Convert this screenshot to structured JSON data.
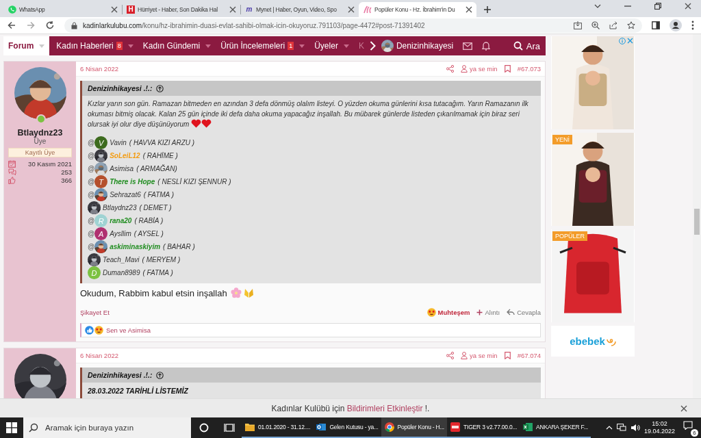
{
  "browser": {
    "tabs": [
      {
        "title": "WhatsApp",
        "selected": false
      },
      {
        "title": "Hürriyet - Haber, Son Dakika Hal",
        "icon_letter": "H",
        "selected": false
      },
      {
        "title": "Mynet | Haber, Oyun, Video, Spo",
        "icon_letter": "m",
        "selected": false
      },
      {
        "title": "Popüler Konu - Hz. İbrahim'in Du",
        "selected": true
      }
    ],
    "url_host": "kadinlarkulubu.com",
    "url_path": "/konu/hz-ibrahimin-duasi-evlat-sahibi-olmak-icin-okuyoruz.791103/page-4472#post-71391402"
  },
  "nav": {
    "items": [
      {
        "label": "Forum",
        "selected": true
      },
      {
        "label": "Kadın Haberleri",
        "badge": "8",
        "selected": false
      },
      {
        "label": "Kadın Gündemi",
        "selected": false
      },
      {
        "label": "Ürün İncelemeleri",
        "badge": "1",
        "selected": false
      },
      {
        "label": "Üyeler",
        "selected": false
      },
      {
        "label": "K",
        "selected": false,
        "faded": true
      }
    ],
    "user": "Denizinhikayesi",
    "search": "Ara"
  },
  "posts": [
    {
      "user": {
        "name": "Btlaydnz23",
        "title": "Üye",
        "banner": "Kayıtlı Üye",
        "online": true,
        "stats": [
          {
            "kind": "calendar",
            "value": "30 Kasım 2021"
          },
          {
            "kind": "messages",
            "value": "253"
          },
          {
            "kind": "likes",
            "value": "366"
          }
        ]
      },
      "date": "6 Nisan 2022",
      "author_link": "ya se min",
      "number": "#67.073",
      "quote": {
        "author": "Denizinhikayesi .!.:",
        "text": "Kızlar yarın son gün. Ramazan bitmeden en azından 3 defa dönmüş olalım listeyi. O yüzden okuma günlerini kısa tutacağım. Yarın Ramazanın ilk okuması bitmiş olacak. Kalan 25 gün içinde iki defa daha okuma yapacağız inşallah. Bu mübarek günlerde listeden çıkarılmamak için biraz seri olursak iyi olur diye düşünüyorum",
        "mentions": [
          {
            "prefix": "@",
            "avatar": {
              "kind": "letter",
              "letter": "V",
              "color": "#3d6b1e"
            },
            "name": "Vavin",
            "note": "( HAVVA KIZI ARZU )"
          },
          {
            "prefix": "@",
            "avatar": {
              "kind": "picture"
            },
            "name": "SoLeiL12",
            "color": "#f39c12",
            "note": "( RAHİME )"
          },
          {
            "prefix": "@",
            "avatar": {
              "kind": "picture"
            },
            "name": "Asimisa",
            "note": "( ARMAĞAN)"
          },
          {
            "prefix": "@",
            "avatar": {
              "kind": "letter",
              "letter": "T",
              "color": "#b5502d"
            },
            "name": "There is Hope",
            "color": "#1e8c1e",
            "note": "( NESLİ KIZI ŞENNUR )"
          },
          {
            "prefix": "@",
            "avatar": {
              "kind": "picture"
            },
            "name": "Sehrazat6",
            "note": "( FATMA )"
          },
          {
            "avatar": {
              "kind": "picture"
            },
            "name": "Btlaydnz23",
            "note": "( DEMET )"
          },
          {
            "prefix": "@",
            "avatar": {
              "kind": "letter",
              "letter": "R",
              "color": "#9fd3d3"
            },
            "name": "rana20",
            "color": "#1e8c1e",
            "note": "( RABİA )"
          },
          {
            "prefix": "@",
            "avatar": {
              "kind": "letter",
              "letter": "A",
              "color": "#b03070"
            },
            "name": "Aysllim",
            "note": "( AYSEL )"
          },
          {
            "prefix": "@",
            "avatar": {
              "kind": "picture"
            },
            "name": "askiminaskiyim",
            "color": "#1e8c1e",
            "note": "( BAHAR )"
          },
          {
            "avatar": {
              "kind": "picture"
            },
            "name": "Teach_Mavi",
            "note": "( MERYEM )"
          },
          {
            "avatar": {
              "kind": "letter",
              "letter": "D",
              "color": "#7cc242"
            },
            "name": "Duman8989",
            "note": "( FATMA )"
          }
        ]
      },
      "body": "Okudum, Rabbim kabul etsin inşallah",
      "report": "Şikayet Et",
      "reaction": "Muhteşem",
      "quote_button": "Alıntı",
      "reply": "Cevapla",
      "reactors": "Sen ve Asimisa"
    },
    {
      "user": {
        "online": false
      },
      "date": "6 Nisan 2022",
      "author_link": "ya se min",
      "number": "#67.074",
      "quote": {
        "author": "Denizinhikayesi .!.:",
        "bold_line": "28.03.2022 TARİHLİ LİSTEMİZ"
      }
    }
  ],
  "ads": [
    {
      "kind": "picture"
    },
    {
      "kind": "picture",
      "label": "YENİ"
    },
    {
      "kind": "picture",
      "label": "POPÜLER"
    }
  ],
  "ad_logo": "ebebek",
  "notification": {
    "text": "Kadınlar Kulübü için",
    "link": "Bildirimleri Etkinleştir",
    "after": "!."
  },
  "taskbar": {
    "search": "Aramak için buraya yazın",
    "apps": [
      {
        "label": "01.01.2020 - 31.12....",
        "selected": false
      },
      {
        "label": "Gelen Kutusu - ya...",
        "selected": false
      },
      {
        "label": "Popüler Konu - H...",
        "selected": true
      },
      {
        "label": "TIGER 3 v2.77.00.0...",
        "selected": false
      },
      {
        "label": "ANKARA ŞEKER F...",
        "selected": false
      }
    ],
    "time": "15:02",
    "date": "19.04.2022",
    "notifications": "6"
  }
}
